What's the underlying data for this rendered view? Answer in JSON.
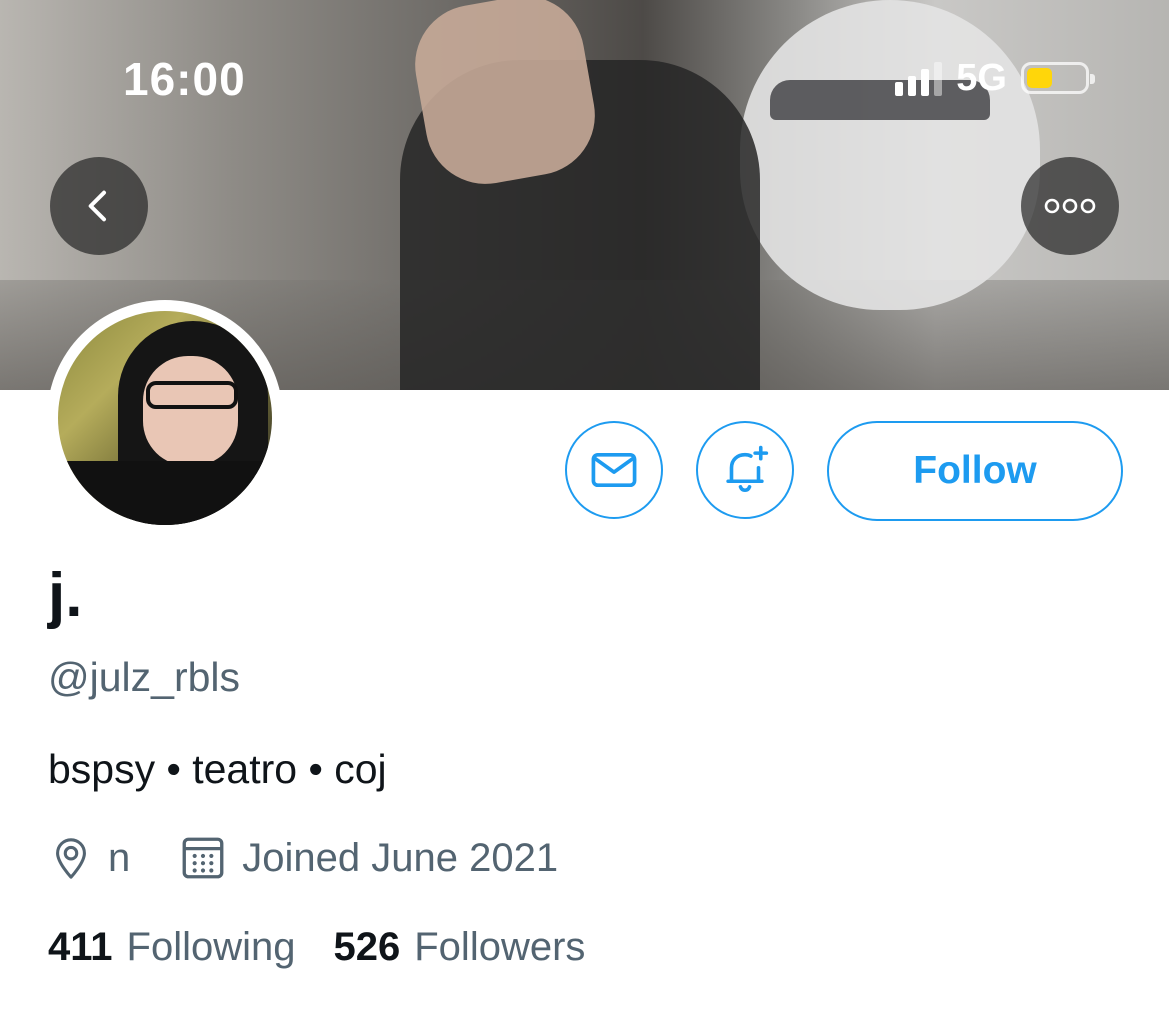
{
  "status_bar": {
    "time": "16:00",
    "network": "5G",
    "signal_bars_active": 3,
    "signal_bars_total": 4,
    "battery_level": 0.45,
    "battery_color": "#ffd60a"
  },
  "header": {
    "back_icon": "chevron-left-icon",
    "more_icon": "more-horizontal-icon"
  },
  "actions": {
    "message_icon": "mail-icon",
    "notify_icon": "bell-plus-icon",
    "follow_label": "Follow",
    "accent_color": "#1d9bf0"
  },
  "profile": {
    "display_name": "j.",
    "handle": "@julz_rbls",
    "bio": "bspsy • teatro • coj",
    "location": "n",
    "joined": "Joined June 2021",
    "following_count": "411",
    "following_label": "Following",
    "followers_count": "526",
    "followers_label": "Followers"
  }
}
